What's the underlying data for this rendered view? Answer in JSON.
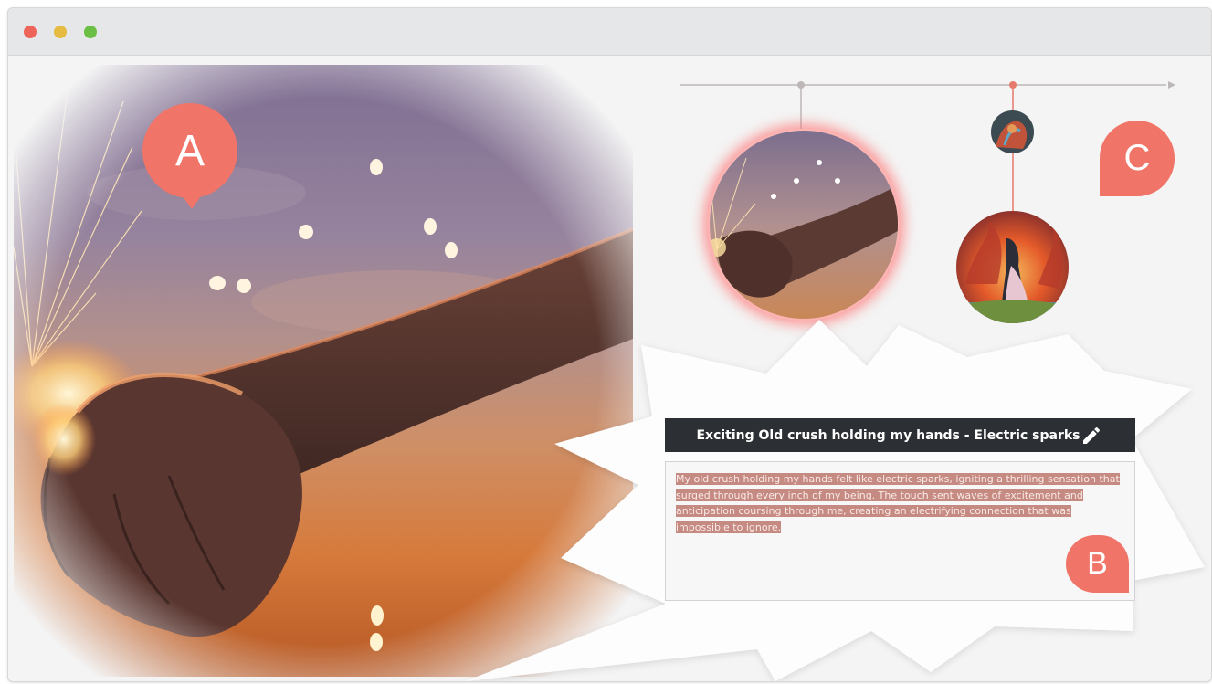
{
  "window": {
    "controls": [
      "close",
      "minimize",
      "maximize"
    ],
    "control_colors": {
      "close": "#ee6459",
      "minimize": "#e5bc41",
      "maximize": "#6cbf45"
    }
  },
  "markers": {
    "a": "A",
    "b": "B",
    "c": "C"
  },
  "timeline": {
    "thumbnails": [
      {
        "name": "holding-hands-sparks",
        "selected": true
      },
      {
        "name": "fire-silhouette-small",
        "selected": false
      },
      {
        "name": "couple-in-flames",
        "selected": false
      }
    ]
  },
  "entry": {
    "title": "Exciting Old crush holding my hands - Electric sparks",
    "description": "My old crush holding my hands felt like electric sparks, igniting a thrilling sensation that surged through every inch of my being. The touch sent waves of excitement and anticipation coursing through me, creating an electrifying connection that was impossible to ignore.",
    "edit_icon": "pencil-icon"
  },
  "colors": {
    "accent": "#f07467",
    "title_bar": "#2c2f33",
    "highlight": "#c58a82"
  }
}
